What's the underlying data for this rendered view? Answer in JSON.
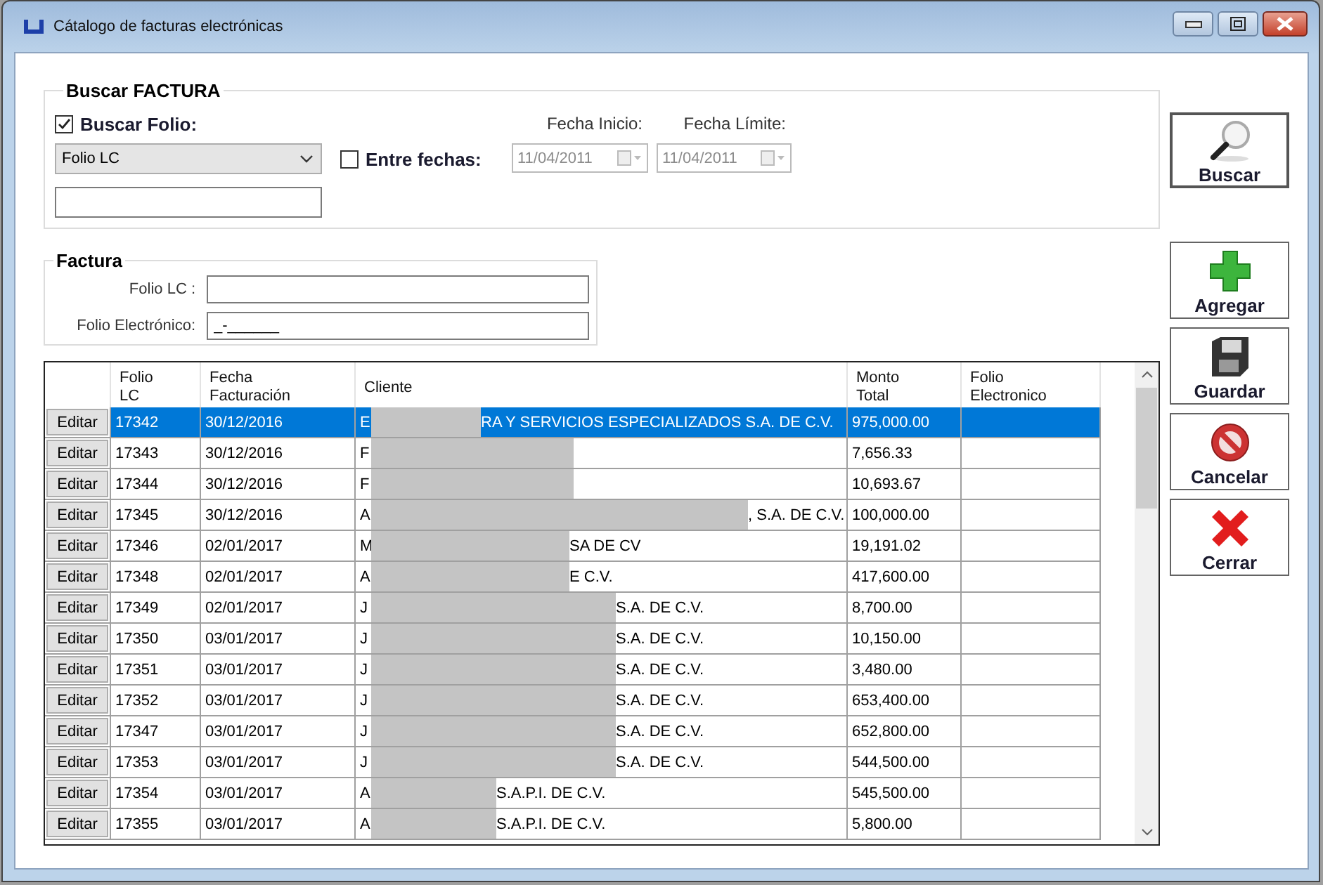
{
  "window": {
    "title": "Cátalogo de facturas electrónicas"
  },
  "search_group": {
    "title": "Buscar FACTURA",
    "buscar_folio": {
      "label": "Buscar Folio:",
      "checked": true
    },
    "folio_type": {
      "value": "Folio LC"
    },
    "entre_fechas": {
      "label": "Entre fechas:",
      "checked": false
    },
    "fecha_inicio": {
      "label": "Fecha Inicio:",
      "value": "11/04/2011",
      "disabled": true
    },
    "fecha_limite": {
      "label": "Fecha Límite:",
      "value": "11/04/2011",
      "disabled": true
    }
  },
  "factura_group": {
    "title": "Factura",
    "fields": [
      {
        "label": "Folio LC :"
      },
      {
        "label": "Folio Electrónico:",
        "value": "_-______"
      }
    ]
  },
  "table": {
    "columns": [
      {
        "lines": [
          "Folio",
          "LC"
        ]
      },
      {
        "lines": [
          "Fecha",
          "Facturación"
        ]
      },
      {
        "lines": [
          "Cliente"
        ]
      },
      {
        "lines": [
          "Monto",
          "Total"
        ]
      },
      {
        "lines": [
          "Folio",
          "Electronico"
        ]
      }
    ],
    "rows": [
      {
        "button": "Editar",
        "folio_lc": "17342",
        "fecha": "30/12/2016",
        "cliente_start": "E",
        "cliente_end": "RA Y SERVICIOS ESPECIALIZADOS S.A. DE C.V.",
        "monto": "975,000.00",
        "selected": true
      },
      {
        "button": "Editar",
        "folio_lc": "17343",
        "fecha": "30/12/2016",
        "cliente_start": "F",
        "monto": "7,656.33",
        "selected": false
      },
      {
        "button": "Editar",
        "folio_lc": "17344",
        "fecha": "30/12/2016",
        "cliente_start": "F",
        "monto": "10,693.67",
        "selected": false
      },
      {
        "button": "Editar",
        "folio_lc": "17345",
        "fecha": "30/12/2016",
        "cliente_start": "A",
        "cliente_end": ", S.A. DE C.V.",
        "monto": "100,000.00",
        "selected": false
      },
      {
        "button": "Editar",
        "folio_lc": "17346",
        "fecha": "02/01/2017",
        "cliente_start": "M",
        "cliente_end": "SA DE CV",
        "monto": "19,191.02",
        "selected": false
      },
      {
        "button": "Editar",
        "folio_lc": "17348",
        "fecha": "02/01/2017",
        "cliente_start": "A",
        "cliente_end": "E C.V.",
        "monto": "417,600.00",
        "selected": false
      },
      {
        "button": "Editar",
        "folio_lc": "17349",
        "fecha": "02/01/2017",
        "cliente_start": "J",
        "cliente_end": "S.A. DE C.V.",
        "monto": "8,700.00",
        "selected": false
      },
      {
        "button": "Editar",
        "folio_lc": "17350",
        "fecha": "03/01/2017",
        "cliente_start": "J",
        "cliente_end": "S.A. DE C.V.",
        "monto": "10,150.00",
        "selected": false
      },
      {
        "button": "Editar",
        "folio_lc": "17351",
        "fecha": "03/01/2017",
        "cliente_start": "J",
        "cliente_end": "S.A. DE C.V.",
        "monto": "3,480.00",
        "selected": false
      },
      {
        "button": "Editar",
        "folio_lc": "17352",
        "fecha": "03/01/2017",
        "cliente_start": "J",
        "cliente_end": "S.A. DE C.V.",
        "monto": "653,400.00",
        "selected": false
      },
      {
        "button": "Editar",
        "folio_lc": "17347",
        "fecha": "03/01/2017",
        "cliente_start": "J",
        "cliente_end": "S.A. DE C.V.",
        "monto": "652,800.00",
        "selected": false
      },
      {
        "button": "Editar",
        "folio_lc": "17353",
        "fecha": "03/01/2017",
        "cliente_start": "J",
        "cliente_end": "S.A. DE C.V.",
        "monto": "544,500.00",
        "selected": false
      },
      {
        "button": "Editar",
        "folio_lc": "17354",
        "fecha": "03/01/2017",
        "cliente_start": "A",
        "cliente_end": "S.A.P.I. DE C.V.",
        "monto": "545,500.00",
        "selected": false
      },
      {
        "button": "Editar",
        "folio_lc": "17355",
        "fecha": "03/01/2017",
        "cliente_start": "A",
        "cliente_end": "S.A.P.I. DE C.V.",
        "monto": "5,800.00",
        "selected": false
      }
    ]
  },
  "buttons": [
    {
      "label": "Buscar",
      "kind": "search"
    },
    {
      "label": "Agregar",
      "kind": "add"
    },
    {
      "label": "Guardar",
      "kind": "save"
    },
    {
      "label": "Cancelar",
      "kind": "cancel"
    },
    {
      "label": "Cerrar",
      "kind": "close"
    }
  ]
}
